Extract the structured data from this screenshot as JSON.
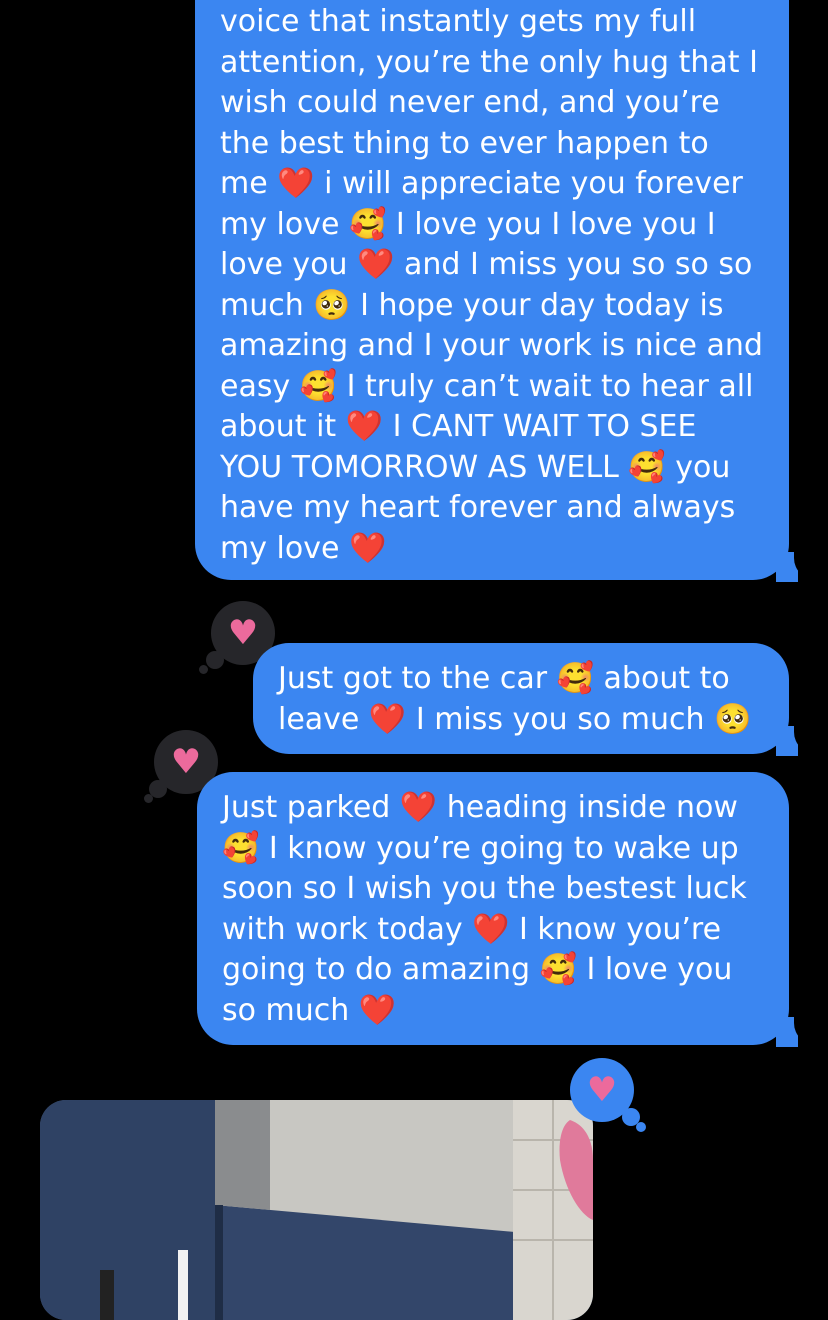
{
  "messages": [
    {
      "sender": "me",
      "text": "voice that instantly gets my full attention, you’re the only hug that I wish could never end, and you’re the best thing to ever happen to me ❤️ i will appreciate you forever my love 🥰 I love you I love you I love you ❤️ and I miss you so so so much 🥺 I hope your day today is amazing and I your work is nice and easy 🥰 I truly can’t wait to hear all about it ❤️ I CANT WAIT TO SEE YOU TOMORROW AS WELL 🥰 you have my heart forever and always my love ❤️",
      "tapback": "heart"
    },
    {
      "sender": "me",
      "text": "Just got to the car 🥰  about to leave ❤️ I miss you so much 🥺",
      "tapback": "heart"
    },
    {
      "sender": "me",
      "text": "Just parked ❤️ heading inside now 🥰 I know you’re going to wake up soon so I wish you the bestest luck with work today ❤️ I know you’re going to do amazing 🥰 I love you so much ❤️",
      "tapback": "heart"
    }
  ],
  "photo": {
    "description": "mirror-photo-attachment"
  },
  "colors": {
    "background": "#000000",
    "bubble": "#3b86f1",
    "tapback_dark": "#26262a",
    "heart": "#ec6a9c"
  },
  "icons": {
    "tapback": "heart-icon"
  }
}
